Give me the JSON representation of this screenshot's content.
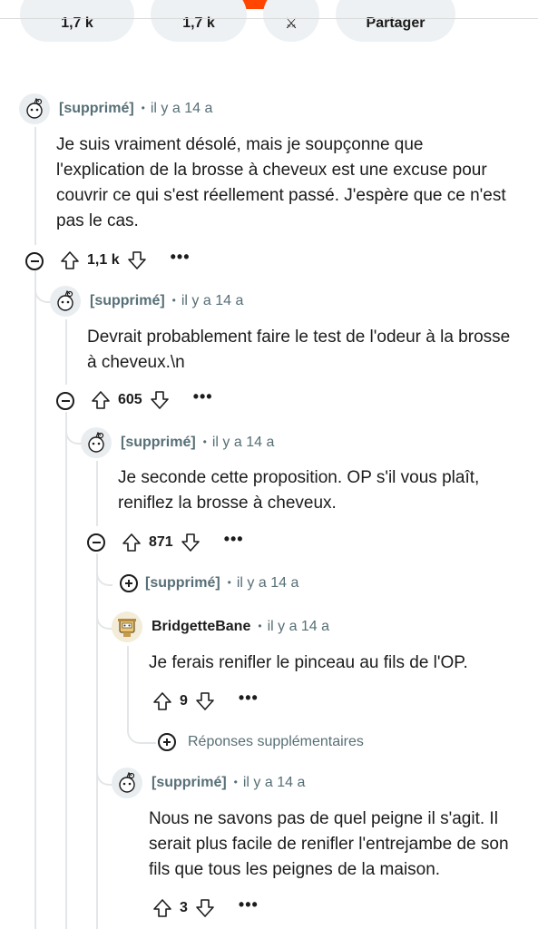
{
  "top_actions": {
    "upvotes": "1,7 k",
    "comments": "1,7 k",
    "share": "Partager"
  },
  "comments": [
    {
      "author": "[supprimé]",
      "time": "il y a 14 a",
      "body": "Je suis vraiment désolé, mais je soupçonne que l'explication de la brosse à cheveux est une excuse pour couvrir ce qui s'est réellement passé. J'espère que ce n'est pas le cas.",
      "score": "1,1 k"
    },
    {
      "author": "[supprimé]",
      "time": "il y a 14 a",
      "body": "Devrait probablement faire le test de l'odeur à la brosse à cheveux.\\n",
      "score": "605"
    },
    {
      "author": "[supprimé]",
      "time": "il y a 14 a",
      "body": "Je seconde cette proposition. OP s'il vous plaît, reniflez la brosse à cheveux.",
      "score": "871"
    },
    {
      "author": "[supprimé]",
      "time": "il y a 14 a"
    },
    {
      "author": "BridgetteBane",
      "time": "il y a 14 a",
      "body": "Je ferais renifler le pinceau au fils de l'OP.",
      "score": "9"
    },
    {
      "author": "[supprimé]",
      "time": "il y a 14 a",
      "body": "Nous ne savons pas de quel peigne il s'agit. Il serait plus facile de renifler l'entrejambe de son fils que tous les peignes de la maison.",
      "score": "3"
    }
  ],
  "more_replies_label": "Réponses supplémentaires",
  "more_label": "•••",
  "colors": {
    "accent": "#ff4500",
    "meta": "#576f76",
    "thread_line": "#e3e6e8"
  }
}
